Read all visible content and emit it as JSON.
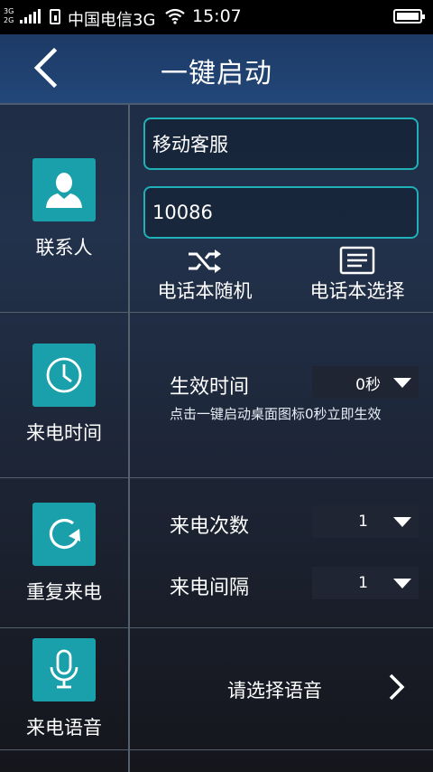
{
  "status_bar": {
    "network_top": "3G",
    "network_bottom": "2G",
    "carrier": "中国电信3G",
    "time": "15:07"
  },
  "header": {
    "title": "一键启动"
  },
  "contact": {
    "label": "联系人",
    "name_value": "移动客服",
    "number_value": "10086",
    "random_label": "电话本随机",
    "select_label": "电话本选择"
  },
  "call_time": {
    "label": "来电时间",
    "effective_label": "生效时间",
    "effective_value": "0秒",
    "hint": "点击一键启动桌面图标0秒立即生效"
  },
  "repeat_call": {
    "label": "重复来电",
    "count_label": "来电次数",
    "count_value": "1",
    "interval_label": "来电间隔",
    "interval_value": "1"
  },
  "call_voice": {
    "label": "来电语音",
    "select_text": "请选择语音"
  },
  "colors": {
    "accent": "#1aa0aa",
    "input_border": "#1fb0b8",
    "header_bg": "#224778"
  }
}
